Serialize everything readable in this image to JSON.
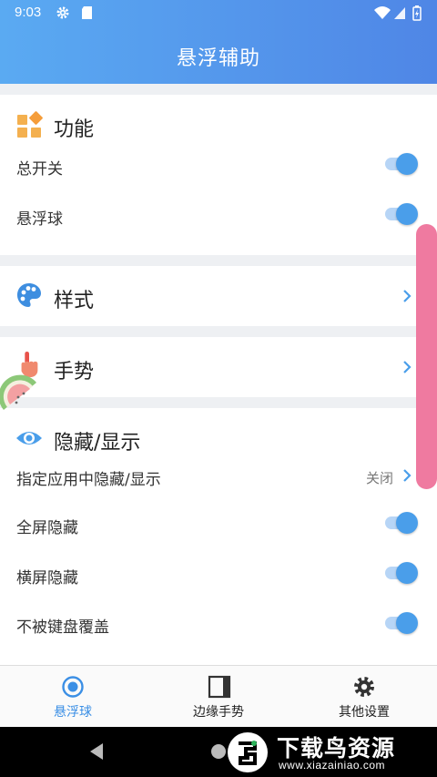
{
  "status_bar": {
    "time": "9:03",
    "icons": [
      "gear-icon",
      "sd-card-icon",
      "wifi-icon",
      "signal-icon",
      "battery-icon"
    ]
  },
  "app_bar": {
    "title": "悬浮辅助"
  },
  "sections": {
    "function": {
      "title": "功能",
      "icon": "grid-blocks-icon",
      "rows": [
        {
          "label": "总开关",
          "toggle": true
        },
        {
          "label": "悬浮球",
          "toggle": true
        }
      ]
    },
    "style": {
      "title": "样式",
      "icon": "palette-icon"
    },
    "gesture": {
      "title": "手势",
      "icon": "pointing-hand-icon"
    },
    "hide_show": {
      "title": "隐藏/显示",
      "icon": "eye-icon",
      "rows": [
        {
          "label": "指定应用中隐藏/显示",
          "value": "关闭"
        },
        {
          "label": "全屏隐藏",
          "toggle": true
        },
        {
          "label": "横屏隐藏",
          "toggle": true
        },
        {
          "label": "不被键盘覆盖",
          "toggle": true
        }
      ]
    }
  },
  "bottom_nav": {
    "items": [
      {
        "label": "悬浮球",
        "icon": "radio-target-icon",
        "active": true
      },
      {
        "label": "边缘手势",
        "icon": "edge-panel-icon",
        "active": false
      },
      {
        "label": "其他设置",
        "icon": "gear-icon",
        "active": false
      }
    ]
  },
  "watermark": {
    "text": "下载鸟资源",
    "url": "www.xiazainiao.com"
  },
  "colors": {
    "accent": "#4a9eea",
    "header_start": "#5aaaf2",
    "header_end": "#4f86e6",
    "scroll_thumb": "#ef7aa0"
  }
}
